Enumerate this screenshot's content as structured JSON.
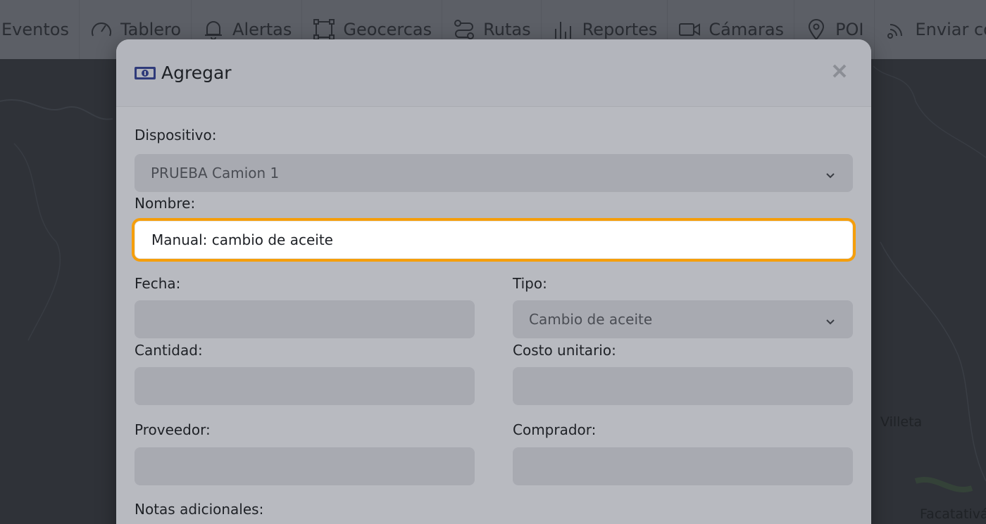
{
  "nav": {
    "items": [
      {
        "label": "Eventos",
        "icon": "events-icon"
      },
      {
        "label": "Tablero",
        "icon": "gauge-icon"
      },
      {
        "label": "Alertas",
        "icon": "bell-icon"
      },
      {
        "label": "Geocercas",
        "icon": "geofence-icon"
      },
      {
        "label": "Rutas",
        "icon": "route-icon"
      },
      {
        "label": "Reportes",
        "icon": "bar-chart-icon"
      },
      {
        "label": "Cámaras",
        "icon": "camera-icon"
      },
      {
        "label": "POI",
        "icon": "map-pin-icon"
      },
      {
        "label": "Enviar comando",
        "icon": "signal-icon"
      }
    ]
  },
  "map": {
    "labels": {
      "villeta": "Villeta",
      "facatativa": "Facatativá"
    }
  },
  "modal": {
    "title": "Agregar",
    "title_icon": "banknote-icon",
    "close_icon": "close-icon",
    "fields": {
      "dispositivo": {
        "label": "Dispositivo:",
        "value": "PRUEBA Camion 1"
      },
      "nombre": {
        "label": "Nombre:",
        "value": "Manual: cambio de aceite"
      },
      "fecha": {
        "label": "Fecha:",
        "value": ""
      },
      "tipo": {
        "label": "Tipo:",
        "value": "Cambio de aceite"
      },
      "cantidad": {
        "label": "Cantidad:",
        "value": ""
      },
      "costo_unitario": {
        "label": "Costo unitario:",
        "value": ""
      },
      "proveedor": {
        "label": "Proveedor:",
        "value": ""
      },
      "comprador": {
        "label": "Comprador:",
        "value": ""
      },
      "notas": {
        "label": "Notas adicionales:"
      }
    }
  },
  "colors": {
    "focus_ring": "#f59e0b",
    "title_icon": "#2f3a7a"
  }
}
